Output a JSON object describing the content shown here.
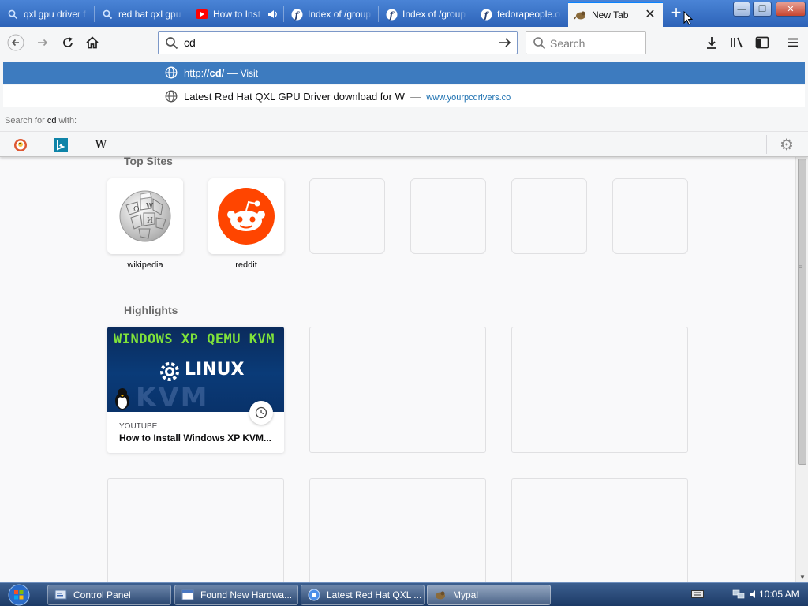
{
  "tabs": [
    {
      "label": "qxl gpu driver f",
      "icon": "search-icon",
      "active": false
    },
    {
      "label": "red hat qxl gpu",
      "icon": "search-icon",
      "active": false
    },
    {
      "label": "How to Inst",
      "icon": "youtube-icon",
      "active": false,
      "audio": true
    },
    {
      "label": "Index of /group",
      "icon": "fedora-icon",
      "active": false
    },
    {
      "label": "Index of /group",
      "icon": "fedora-icon",
      "active": false
    },
    {
      "label": "fedorapeople.o",
      "icon": "fedora-icon",
      "active": false
    },
    {
      "label": "New Tab",
      "icon": "mypal-icon",
      "active": true
    }
  ],
  "new_tab_symbol": "+",
  "window_controls": {
    "minimize": "—",
    "maximize": "❐",
    "close": "✕"
  },
  "nav": {
    "url_value": "cd",
    "search_placeholder": "Search"
  },
  "dropdown": {
    "selected": {
      "title_prefix": "http://",
      "title_bold": "cd",
      "title_suffix": "/",
      "separator": "—",
      "action": "Visit"
    },
    "suggestion": {
      "title": "Latest Red Hat QXL GPU Driver download for W",
      "separator": "—",
      "url": "www.yourpcdrivers.co"
    },
    "search_for_prefix": "Search for ",
    "search_for_term": "cd",
    "search_for_suffix": " with:",
    "engines": [
      "duckduckgo-icon",
      "bing-icon",
      "wikipedia-icon"
    ],
    "wikipedia_glyph": "W"
  },
  "top_sites": {
    "title": "Top Sites",
    "tiles": [
      {
        "label": "wikipedia",
        "icon": "wikipedia-globe-icon"
      },
      {
        "label": "reddit",
        "icon": "reddit-icon"
      },
      {
        "label": "",
        "icon": ""
      },
      {
        "label": "",
        "icon": ""
      },
      {
        "label": "",
        "icon": ""
      },
      {
        "label": "",
        "icon": ""
      }
    ]
  },
  "highlights": {
    "title": "Highlights",
    "card": {
      "image_line1": "WINDOWS XP QEMU KVM",
      "image_line2": "LINUX",
      "image_line3": "KVM",
      "source": "YOUTUBE",
      "title": "How to Install Windows XP KVM..."
    }
  },
  "taskbar": {
    "buttons": [
      {
        "label": "Control Panel",
        "icon": "control-panel-icon"
      },
      {
        "label": "Found New Hardwa...",
        "icon": "window-icon"
      },
      {
        "label": "Latest Red Hat QXL ...",
        "icon": "browser-icon"
      },
      {
        "label": "Mypal",
        "icon": "mypal-icon"
      }
    ],
    "clock": "10:05 AM"
  },
  "colors": {
    "tabstrip": "#2d63b8",
    "selected_row": "#3d7bbf",
    "reddit": "#ff4500",
    "accent": "#0a84ff"
  }
}
